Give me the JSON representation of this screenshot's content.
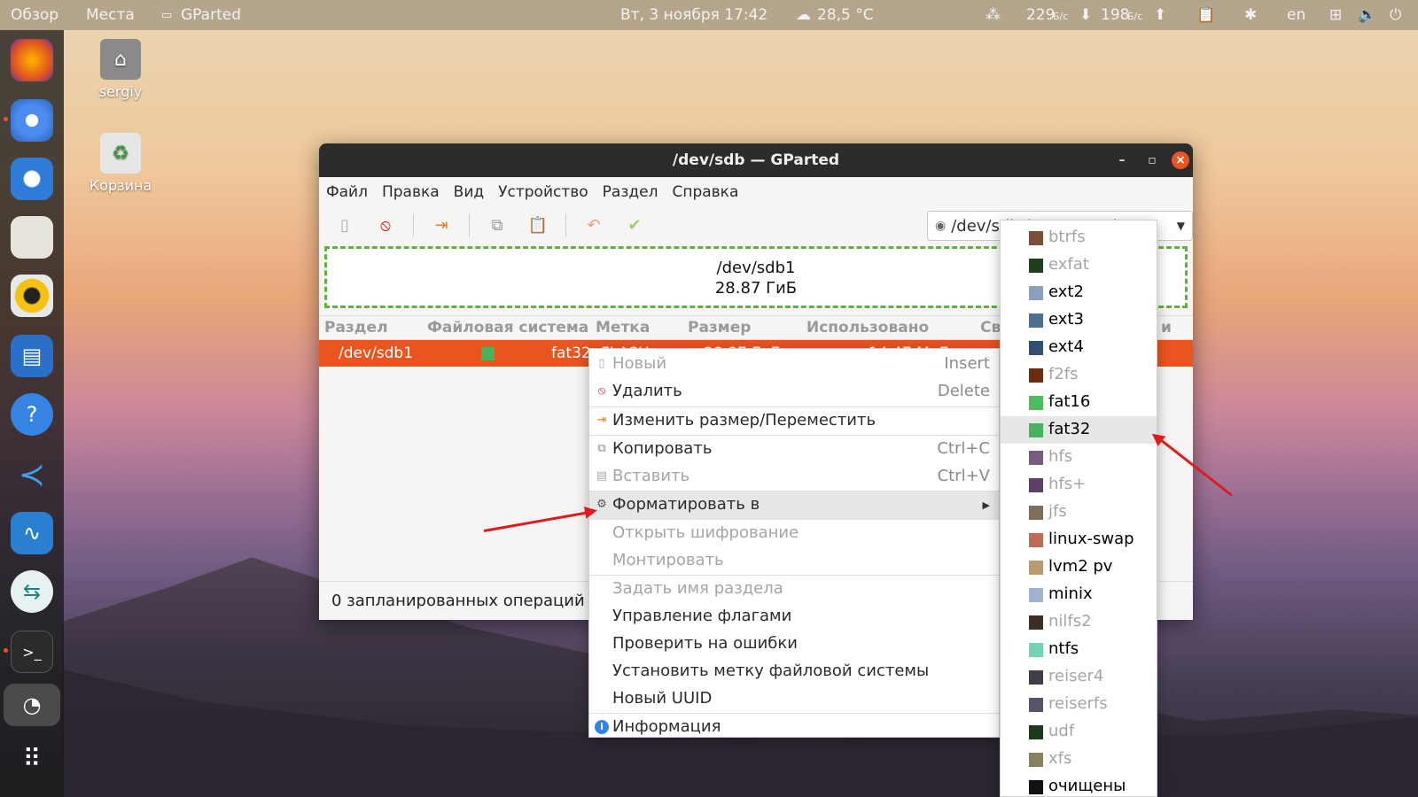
{
  "topbar": {
    "overview": "Обзор",
    "places": "Места",
    "app": "GParted",
    "datetime": "Вт, 3 ноября  17:42",
    "weather": "28,5 °C",
    "down_value": "229",
    "down_unit": "Б/с",
    "up_value": "198",
    "up_unit": "Б/с",
    "lang": "en"
  },
  "desktop": {
    "home_label": "sergiy",
    "trash_label": "Корзина"
  },
  "window": {
    "title": "/dev/sdb — GParted",
    "menu": [
      "Файл",
      "Правка",
      "Вид",
      "Устройство",
      "Раздел",
      "Справка"
    ],
    "device_selector": "/dev/sdb     (28.88 ГиБ)",
    "graph_device": "/dev/sdb1",
    "graph_size": "28.87 ГиБ",
    "columns": [
      "Раздел",
      "Файловая система",
      "Метка",
      "Размер",
      "Использовано",
      "Св",
      "и"
    ],
    "row": {
      "partition": "/dev/sdb1",
      "fs": "fat32",
      "label": "FLASH",
      "size": "28.87 ГиБ",
      "used": "14.47 МиБ"
    },
    "status": "0 запланированных операций"
  },
  "context_menu": {
    "new": "Новый",
    "new_sc": "Insert",
    "delete": "Удалить",
    "delete_sc": "Delete",
    "resize": "Изменить размер/Переместить",
    "copy": "Копировать",
    "copy_sc": "Ctrl+C",
    "paste": "Вставить",
    "paste_sc": "Ctrl+V",
    "format": "Форматировать в",
    "open_enc": "Открыть шифрование",
    "mount": "Монтировать",
    "set_name": "Задать имя раздела",
    "flags": "Управление флагами",
    "check": "Проверить на ошибки",
    "set_label": "Установить метку файловой системы",
    "new_uuid": "Новый UUID",
    "info": "Информация"
  },
  "fs_submenu": [
    {
      "name": "btrfs",
      "color": "#7b4f36",
      "enabled": false
    },
    {
      "name": "exfat",
      "color": "#1f3d1f",
      "enabled": false
    },
    {
      "name": "ext2",
      "color": "#8aa0bf",
      "enabled": true
    },
    {
      "name": "ext3",
      "color": "#4f6f91",
      "enabled": true
    },
    {
      "name": "ext4",
      "color": "#2f4f74",
      "enabled": true
    },
    {
      "name": "f2fs",
      "color": "#6e2a15",
      "enabled": false
    },
    {
      "name": "fat16",
      "color": "#4dbd5c",
      "enabled": true
    },
    {
      "name": "fat32",
      "color": "#47b35a",
      "enabled": true,
      "selected": true
    },
    {
      "name": "hfs",
      "color": "#7a5a80",
      "enabled": false
    },
    {
      "name": "hfs+",
      "color": "#5a3f66",
      "enabled": false
    },
    {
      "name": "jfs",
      "color": "#7d6f5a",
      "enabled": false
    },
    {
      "name": "linux-swap",
      "color": "#c06a5a",
      "enabled": true
    },
    {
      "name": "lvm2 pv",
      "color": "#b89a6e",
      "enabled": true
    },
    {
      "name": "minix",
      "color": "#9fb3d0",
      "enabled": true
    },
    {
      "name": "nilfs2",
      "color": "#3f2e24",
      "enabled": false
    },
    {
      "name": "ntfs",
      "color": "#6fd4b4",
      "enabled": true
    },
    {
      "name": "reiser4",
      "color": "#3f3f4a",
      "enabled": false
    },
    {
      "name": "reiserfs",
      "color": "#55556a",
      "enabled": false
    },
    {
      "name": "udf",
      "color": "#1a3a1a",
      "enabled": false
    },
    {
      "name": "xfs",
      "color": "#8a8060",
      "enabled": false
    },
    {
      "name": "очищены",
      "color": "#111111",
      "enabled": true
    }
  ],
  "colors": {
    "accent": "#e95420",
    "partition_green": "#47b35a"
  }
}
